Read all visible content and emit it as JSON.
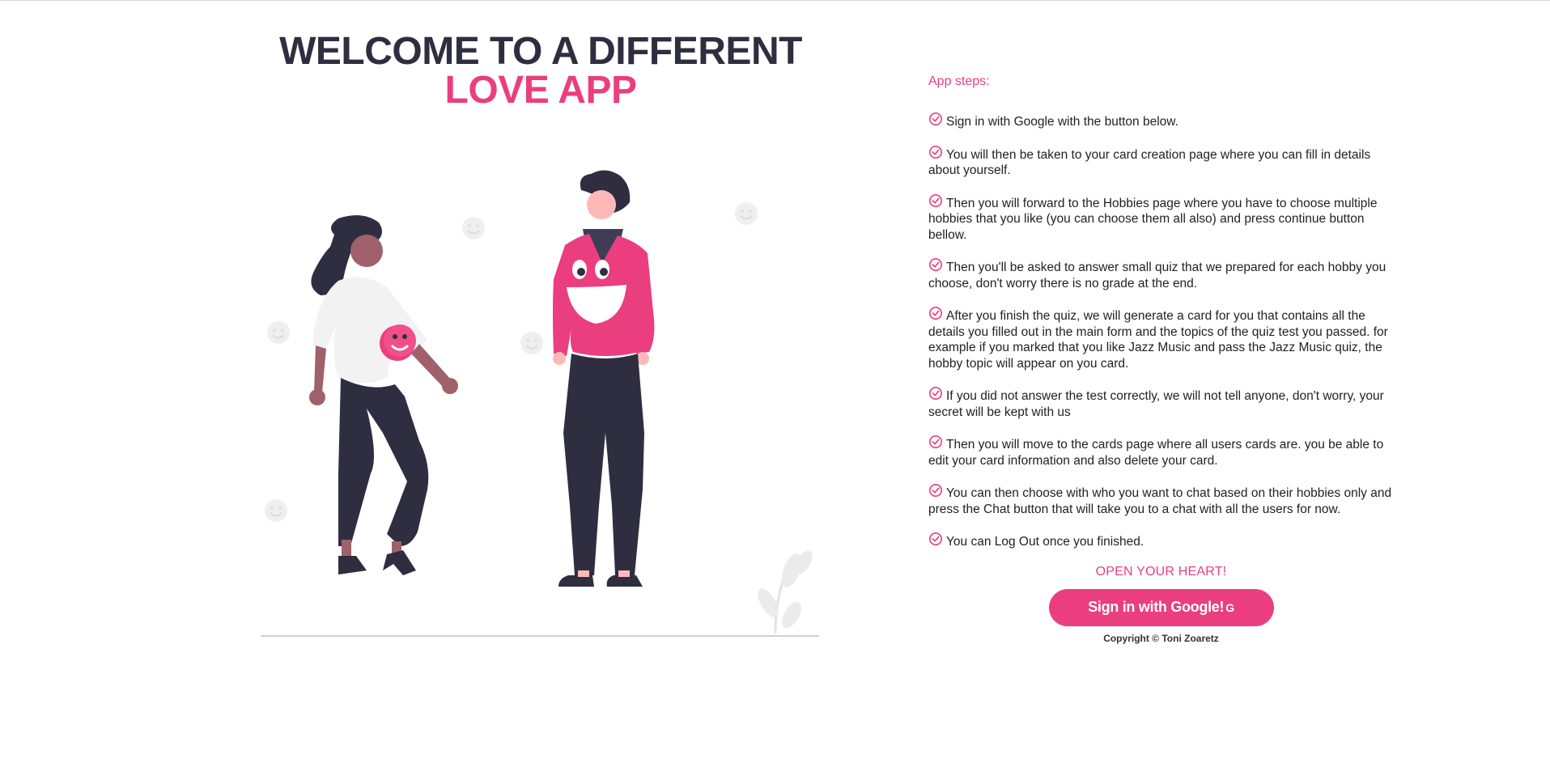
{
  "hero": {
    "title_line1": "WELCOME TO A DIFFERENT",
    "title_line2": "LOVE APP"
  },
  "steps": {
    "heading": "App steps:",
    "items": [
      "Sign in with Google with the button below.",
      "You will then be taken to your card creation page where you can fill in details about yourself.",
      "Then you will forward to the Hobbies page where you have to choose multiple hobbies that you like (you can choose them all also) and press continue button bellow.",
      "Then you'll be asked to answer small quiz that we prepared for each hobby you choose, don't worry there is no grade at the end.",
      "After you finish the quiz, we will generate a card for you that contains all the details you filled out in the main form and the topics of the quiz test you passed. for example if you marked that you like Jazz Music and pass the Jazz Music quiz, the hobby topic will appear on you card.",
      "If you did not answer the test correctly, we will not tell anyone, don't worry, your secret will be kept with us",
      "Then you will move to the cards page where all users cards are. you be able to edit your card information and also delete your card.",
      "You can then choose with who you want to chat based on their hobbies only and press the Chat button that will take you to a chat with all the users for now.",
      "You can Log Out once you finished."
    ]
  },
  "cta": {
    "tagline": "OPEN YOUR HEART!",
    "signin_label": "Sign in with Google!",
    "signin_icon": "G"
  },
  "footer": {
    "copyright": "Copyright © Toni Zoaretz"
  },
  "colors": {
    "accent": "#ea3e7f",
    "dark": "#2f2e41"
  },
  "icons": {
    "step_icon": "check-circle-icon",
    "google_icon": "google-icon"
  }
}
